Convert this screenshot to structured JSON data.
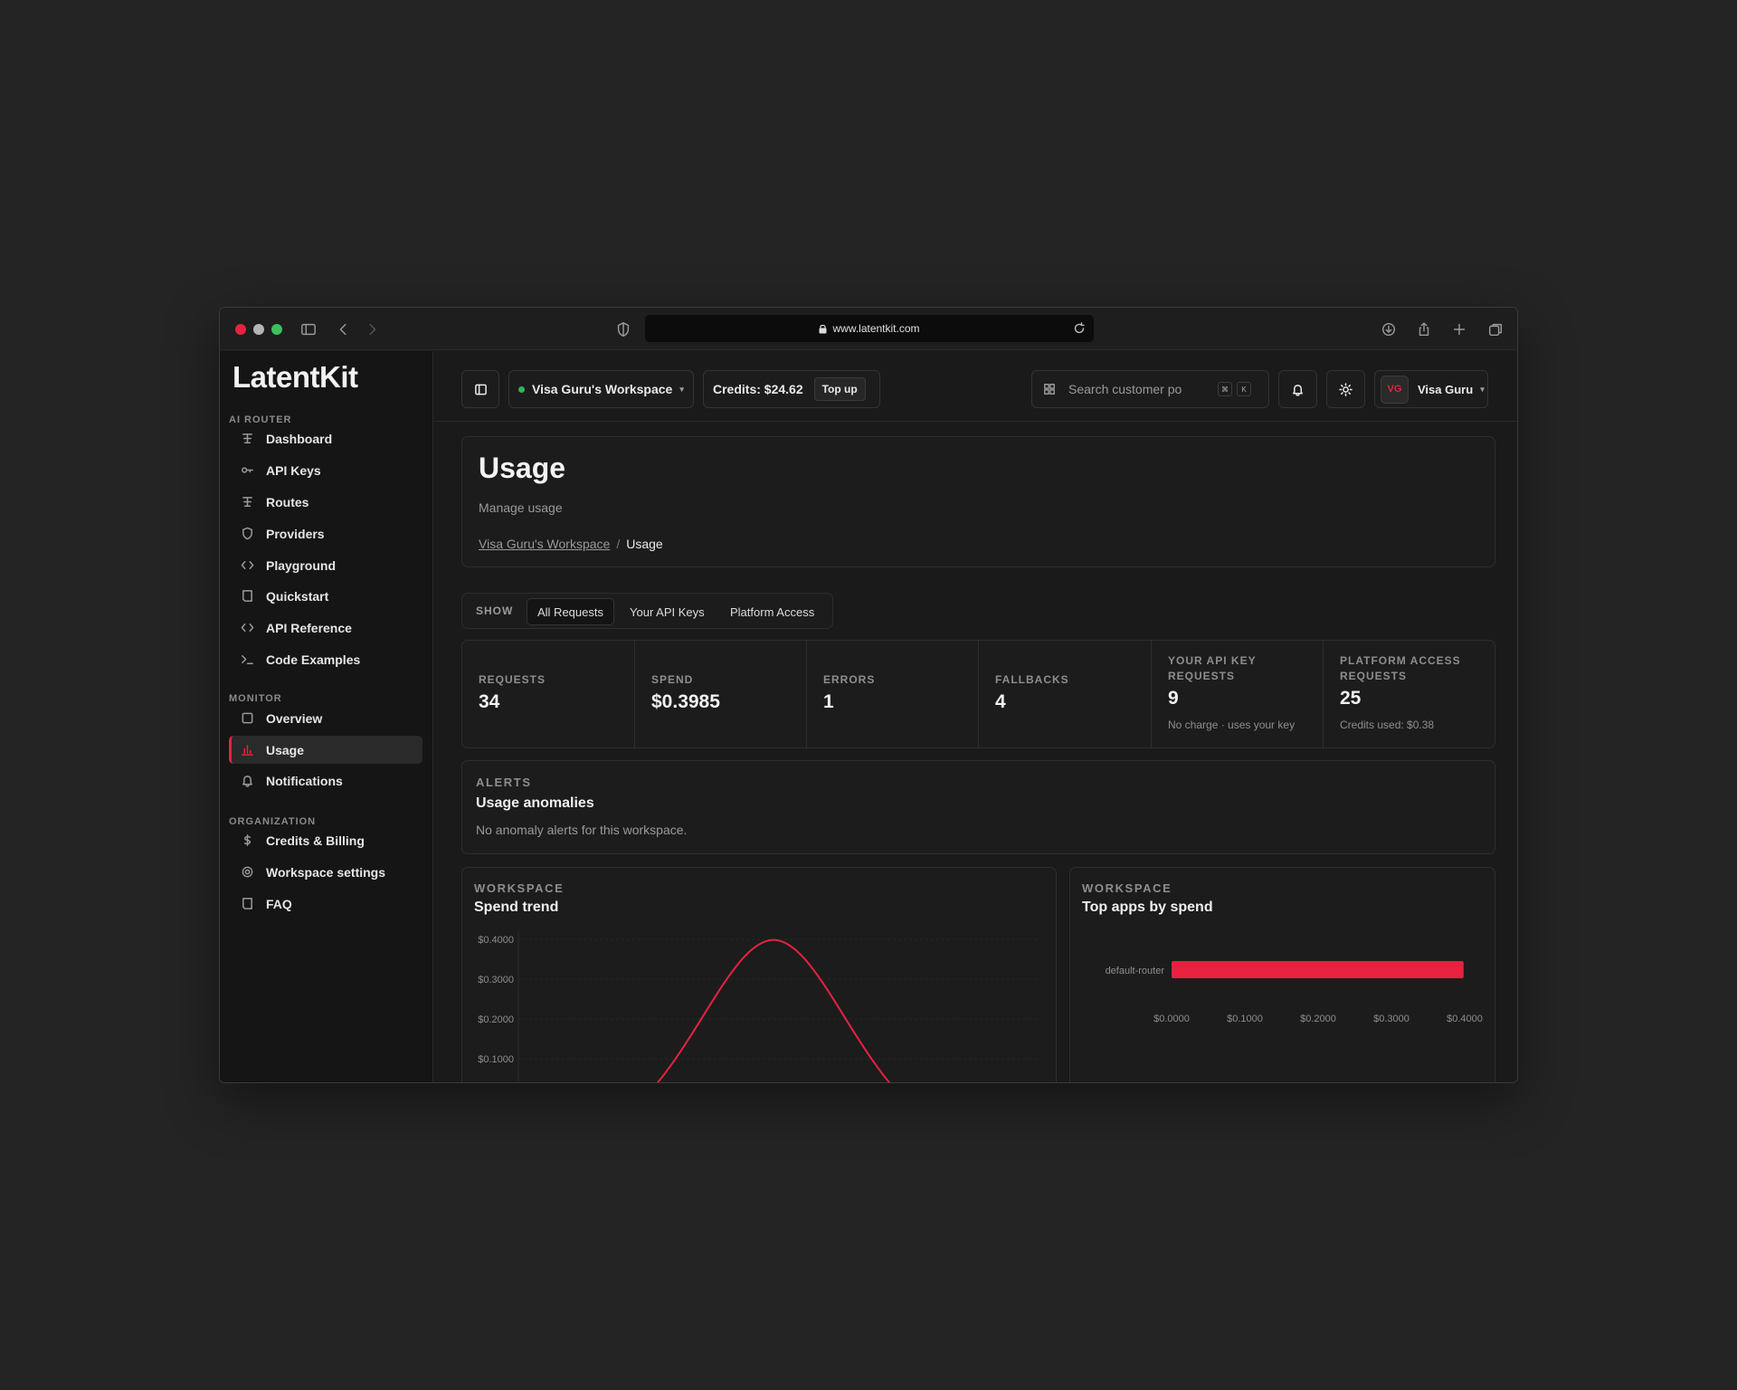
{
  "browser": {
    "url": "www.latentkit.com"
  },
  "sidebar": {
    "logo": "LatentKit",
    "sections": [
      {
        "label": "AI ROUTER",
        "items": [
          "Dashboard",
          "API Keys",
          "Routes",
          "Providers",
          "Playground",
          "Quickstart",
          "API Reference",
          "Code Examples"
        ]
      },
      {
        "label": "MONITOR",
        "items": [
          "Overview",
          "Usage",
          "Notifications"
        ]
      },
      {
        "label": "ORGANIZATION",
        "items": [
          "Credits & Billing",
          "Workspace settings",
          "FAQ"
        ]
      }
    ],
    "active_item": "Usage"
  },
  "topbar": {
    "workspace": "Visa Guru's Workspace",
    "credits": "Credits: $24.62",
    "topup": "Top up",
    "search_placeholder": "Search customer po",
    "kbd_1": "⌘",
    "kbd_2": "K",
    "avatar_initials": "VG",
    "user_name": "Visa Guru"
  },
  "header": {
    "title": "Usage",
    "subtitle": "Manage usage",
    "breadcrumb_link": "Visa Guru's Workspace",
    "breadcrumb_sep": "/",
    "breadcrumb_current": "Usage"
  },
  "filter": {
    "label": "SHOW",
    "tabs": [
      "All Requests",
      "Your API Keys",
      "Platform Access"
    ],
    "selected": "All Requests"
  },
  "stats": [
    {
      "label": "REQUESTS",
      "value": "34",
      "sub": ""
    },
    {
      "label": "SPEND",
      "value": "$0.3985",
      "sub": ""
    },
    {
      "label": "ERRORS",
      "value": "1",
      "sub": ""
    },
    {
      "label": "FALLBACKS",
      "value": "4",
      "sub": ""
    },
    {
      "label": "YOUR API KEY REQUESTS",
      "value": "9",
      "sub": "No charge · uses your key"
    },
    {
      "label": "PLATFORM ACCESS REQUESTS",
      "value": "25",
      "sub": "Credits used: $0.38"
    }
  ],
  "alerts": {
    "eyebrow": "ALERTS",
    "title": "Usage anomalies",
    "body": "No anomaly alerts for this workspace."
  },
  "spend_card": {
    "eyebrow": "WORKSPACE",
    "title": "Spend trend"
  },
  "apps_card": {
    "eyebrow": "WORKSPACE",
    "title": "Top apps by spend"
  },
  "chart_data": [
    {
      "type": "line",
      "title": "Spend trend",
      "y_ticks": [
        "$0.4000",
        "$0.3000",
        "$0.2000",
        "$0.1000"
      ],
      "ylim": [
        0,
        0.4
      ],
      "series": [
        {
          "values": [
            0,
            0,
            0,
            0.3985,
            0,
            0,
            0
          ]
        }
      ],
      "color": "#e6223f",
      "grid": true
    },
    {
      "type": "bar",
      "orientation": "horizontal",
      "title": "Top apps by spend",
      "categories": [
        "default-router"
      ],
      "values": [
        0.3985
      ],
      "x_ticks": [
        "$0.0000",
        "$0.1000",
        "$0.2000",
        "$0.3000",
        "$0.4000"
      ],
      "xlim": [
        0,
        0.4
      ],
      "color": "#e6223f"
    }
  ]
}
